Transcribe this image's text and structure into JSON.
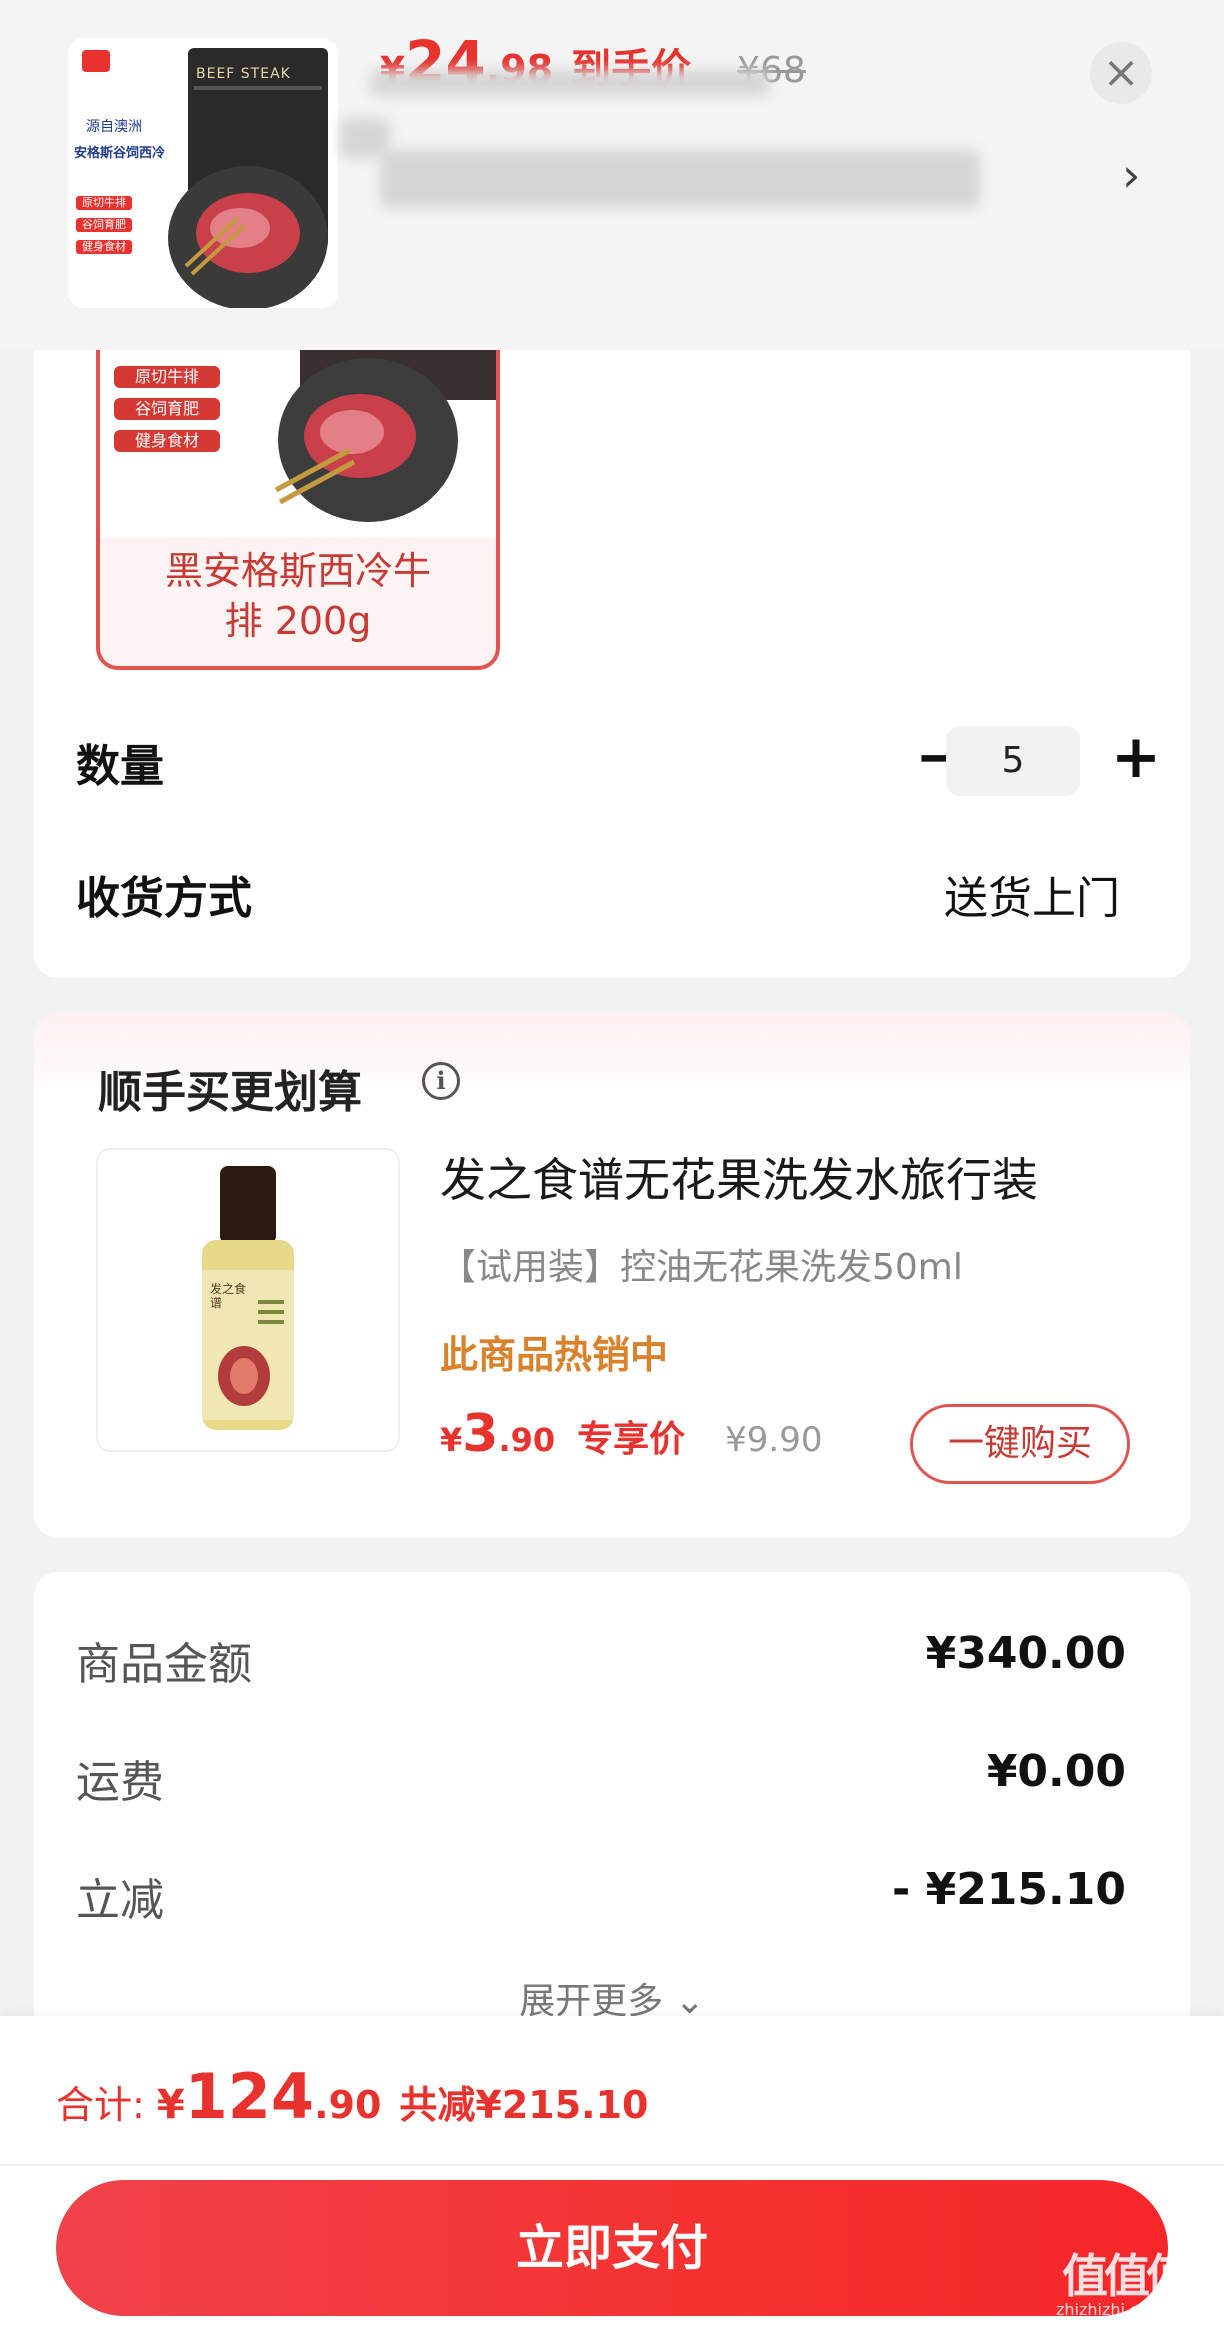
{
  "header": {
    "price_yen": "¥",
    "price_int": "24",
    "price_dec": ".98",
    "price_tag": "到手价",
    "price_orig": "¥68",
    "thumb_brand_tag": "源自澳洲",
    "thumb_subtitle": "安格斯谷饲西冷",
    "thumb_badges": [
      "原切牛排",
      "谷饲育肥",
      "健身食材"
    ],
    "thumb_pack_label": "BEEF STEAK",
    "close_symbol": "×",
    "chevron": "›"
  },
  "spec": {
    "badges": [
      "原切牛排",
      "谷饲育肥",
      "健身食材"
    ],
    "name_line1": "黑安格斯西冷牛",
    "name_line2": "排 200g"
  },
  "order": {
    "quantity_label": "数量",
    "quantity_minus": "−",
    "quantity_value": "5",
    "quantity_plus": "+",
    "delivery_label": "收货方式",
    "delivery_value": "送货上门"
  },
  "upsell": {
    "title": "顺手买更划算",
    "info_symbol": "i",
    "product_name": "发之食谱无花果洗发水旅行装",
    "product_desc": "【试用装】控油无花果洗发50ml",
    "hot_label": "此商品热销中",
    "price_yen": "¥",
    "price_int": "3",
    "price_dec": ".90",
    "price_tag": "专享价",
    "price_orig": "¥9.90",
    "buy_label": "一键购买",
    "bottle_label": "发之食谱"
  },
  "summary": {
    "items": [
      {
        "label": "商品金额",
        "value": "¥340.00"
      },
      {
        "label": "运费",
        "value": "¥0.00"
      },
      {
        "label": "立减",
        "value": "- ¥215.10"
      }
    ],
    "expand_label": "展开更多 ⌄"
  },
  "footer": {
    "total_label": "合计:",
    "total_yen": "¥",
    "total_int": "124",
    "total_dec": ".90",
    "discount_text": "共减¥215.10",
    "pay_label": "立即支付",
    "watermark": "值值值",
    "watermark_sub": "zhizhizhi.com"
  },
  "colors": {
    "accent": "#e8322e",
    "hot": "#d9822b",
    "background": "#f2f2f2"
  }
}
